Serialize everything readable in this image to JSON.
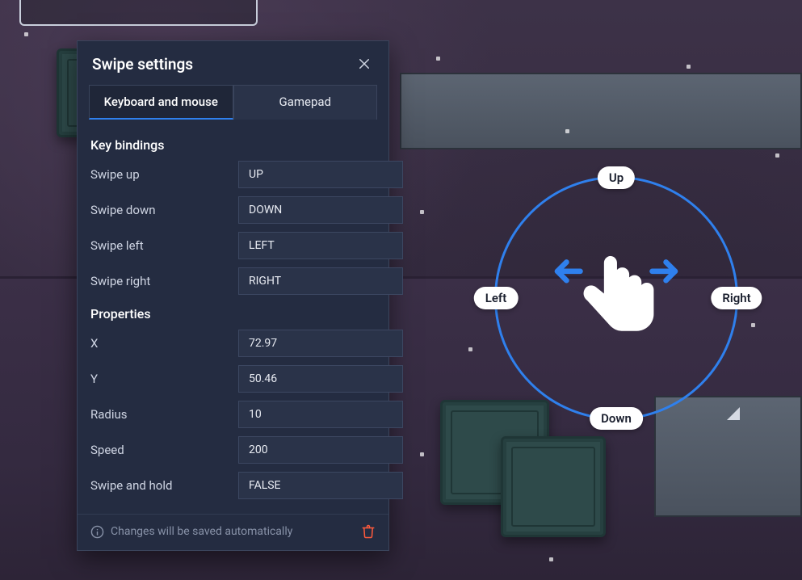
{
  "panel": {
    "title": "Swipe settings",
    "tabs": {
      "keyboard": "Keyboard and mouse",
      "gamepad": "Gamepad"
    },
    "sections": {
      "key_bindings": "Key bindings",
      "properties": "Properties"
    },
    "bindings": {
      "swipe_up": {
        "label": "Swipe up",
        "value": "UP"
      },
      "swipe_down": {
        "label": "Swipe down",
        "value": "DOWN"
      },
      "swipe_left": {
        "label": "Swipe left",
        "value": "LEFT"
      },
      "swipe_right": {
        "label": "Swipe right",
        "value": "RIGHT"
      }
    },
    "properties": {
      "x": {
        "label": "X",
        "value": "72.97"
      },
      "y": {
        "label": "Y",
        "value": "50.46"
      },
      "radius": {
        "label": "Radius",
        "value": "10"
      },
      "speed": {
        "label": "Speed",
        "value": "200"
      },
      "hold": {
        "label": "Swipe and hold",
        "value": "FALSE"
      }
    },
    "footer": "Changes will be saved automatically"
  },
  "overlay": {
    "pills": {
      "up": "Up",
      "down": "Down",
      "left": "Left",
      "right": "Right"
    },
    "icons": {
      "hand": "hand-pointer-icon",
      "arrow_left": "arrow-left-icon",
      "arrow_right": "arrow-right-icon"
    }
  },
  "colors": {
    "accent": "#2f80ed",
    "panel_bg": "#242c41",
    "input_bg": "#2a3349",
    "danger": "#ff5a3c"
  }
}
